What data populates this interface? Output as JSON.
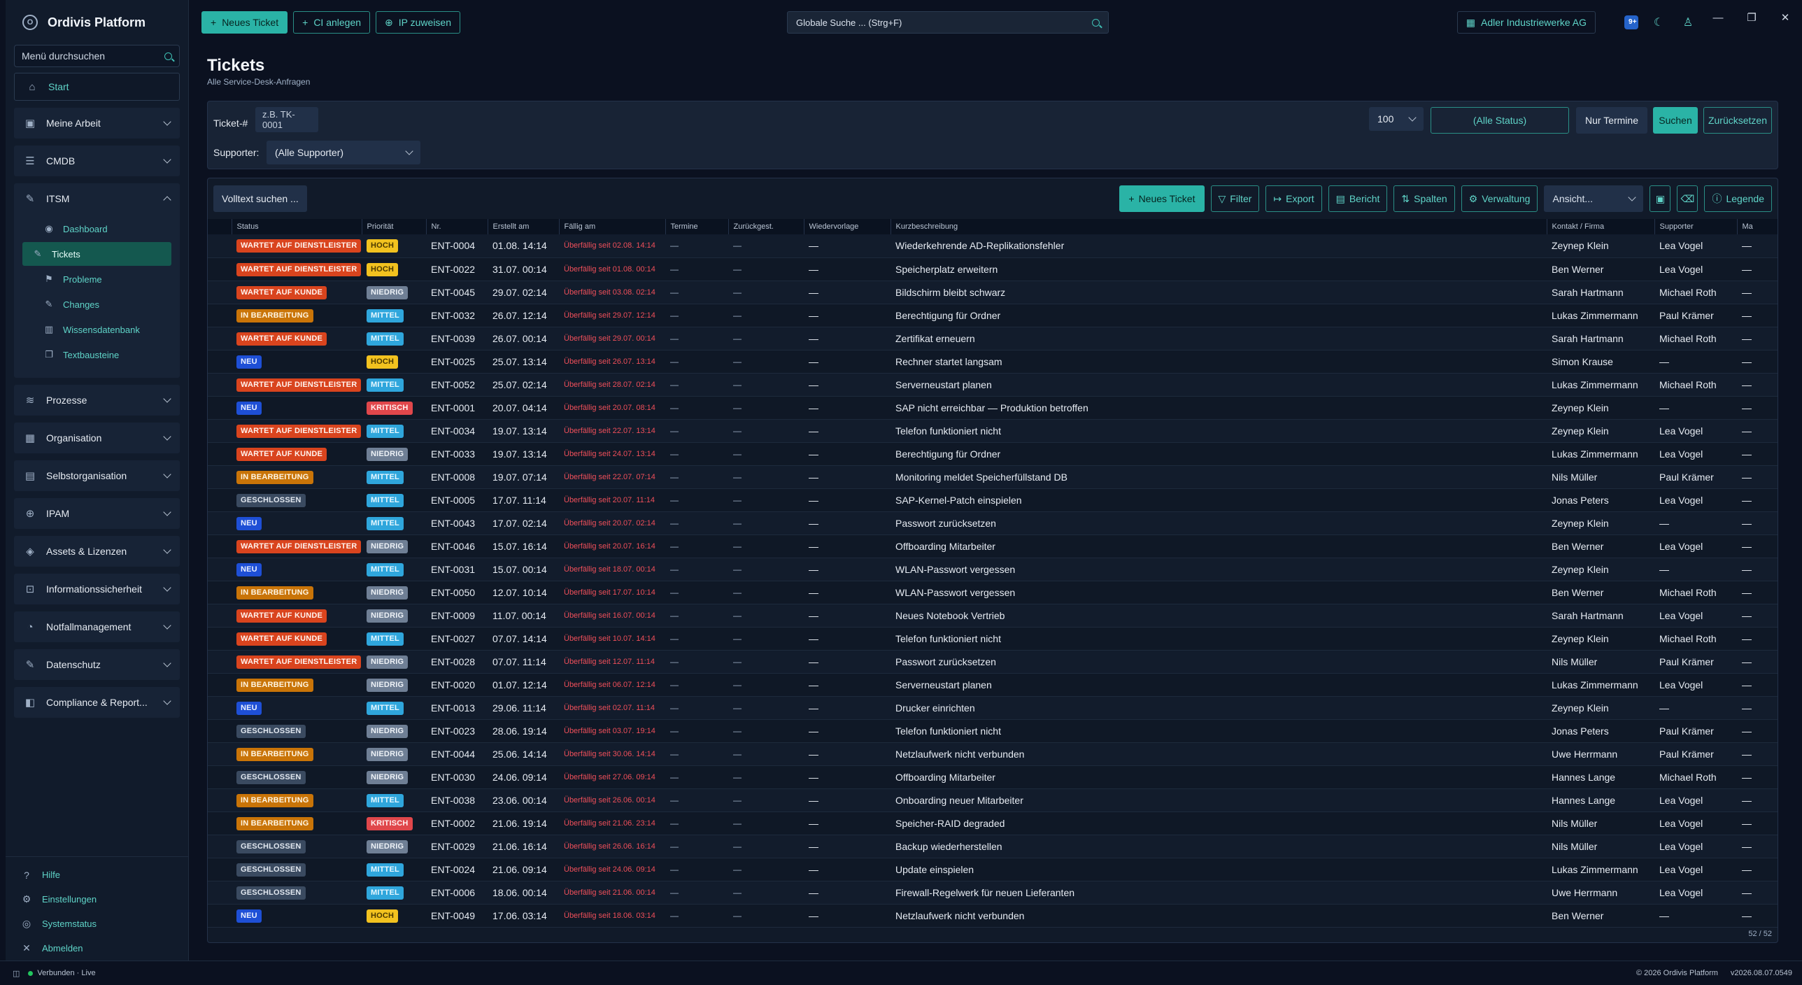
{
  "brand": {
    "name": "Ordivis Platform"
  },
  "sidebar": {
    "search_placeholder": "Menü durchsuchen",
    "start": "Start",
    "groups_top": [
      {
        "label": "Meine Arbeit",
        "icon": "briefcase-icon"
      },
      {
        "label": "CMDB",
        "icon": "database-icon"
      }
    ],
    "itsm": {
      "label": "ITSM",
      "items": [
        {
          "label": "Dashboard",
          "icon": "eye-icon"
        },
        {
          "label": "Tickets",
          "icon": "wrench-icon"
        },
        {
          "label": "Probleme",
          "icon": "flag-icon"
        },
        {
          "label": "Changes",
          "icon": "wrench-icon"
        },
        {
          "label": "Wissensdatenbank",
          "icon": "library-icon"
        },
        {
          "label": "Textbausteine",
          "icon": "copy-icon"
        }
      ]
    },
    "groups_bottom": [
      {
        "label": "Prozesse",
        "icon": "layers-icon"
      },
      {
        "label": "Organisation",
        "icon": "building-icon"
      },
      {
        "label": "Selbstorganisation",
        "icon": "clipboard-icon"
      },
      {
        "label": "IPAM",
        "icon": "network-icon"
      },
      {
        "label": "Assets & Lizenzen",
        "icon": "tag-icon"
      },
      {
        "label": "Informationssicherheit",
        "icon": "lock-icon"
      },
      {
        "label": "Notfallmanagement",
        "icon": "bell-icon"
      },
      {
        "label": "Datenschutz",
        "icon": "key-icon"
      },
      {
        "label": "Compliance & Report...",
        "icon": "report-icon"
      }
    ],
    "footer": [
      {
        "label": "Hilfe",
        "icon": "help-icon"
      },
      {
        "label": "Einstellungen",
        "icon": "gear-icon"
      },
      {
        "label": "Systemstatus",
        "icon": "status-icon"
      },
      {
        "label": "Abmelden",
        "icon": "close-icon"
      }
    ]
  },
  "topbar": {
    "new_ticket": "Neues Ticket",
    "ci_create": "CI anlegen",
    "ip_assign": "IP zuweisen",
    "global_search": "Globale Suche ... (Strg+F)",
    "company": "Adler Industriewerke AG",
    "notif_badge": "9+"
  },
  "page": {
    "title": "Tickets",
    "subtitle": "Alle Service-Desk-Anfragen"
  },
  "filters": {
    "ticket_label": "Ticket-#",
    "ticket_placeholder": "z.B. TK-0001",
    "supporter_label": "Supporter:",
    "supporter_value": "(Alle Supporter)",
    "limit_value": "100",
    "status_value": "(Alle Status)",
    "only_dates": "Nur Termine",
    "search": "Suchen",
    "reset": "Zurücksetzen"
  },
  "toolbar": {
    "fulltext": "Volltext suchen ...",
    "new_ticket": "Neues Ticket",
    "filter": "Filter",
    "export": "Export",
    "report": "Bericht",
    "columns": "Spalten",
    "admin": "Verwaltung",
    "view": "Ansicht...",
    "legend": "Legende"
  },
  "table": {
    "headers": [
      "Status",
      "Priorität",
      "Nr.",
      "Erstellt am",
      "Fällig am",
      "Termine",
      "Zurückgest.",
      "Wiedervorlage",
      "Kurzbeschreibung",
      "Kontakt / Firma",
      "Supporter",
      "Ma"
    ],
    "rows": [
      [
        "WARTET AUF DIENSTLEISTER",
        "HOCH",
        "ENT-0004",
        "01.08. 14:14",
        "Überfällig seit 02.08. 14:14",
        "—",
        "—",
        "Wiederkehrende AD-Replikationsfehler",
        "Zeynep Klein",
        "Lea Vogel",
        "—"
      ],
      [
        "WARTET AUF DIENSTLEISTER",
        "HOCH",
        "ENT-0022",
        "31.07. 00:14",
        "Überfällig seit 01.08. 00:14",
        "—",
        "—",
        "Speicherplatz erweitern",
        "Ben Werner",
        "Lea Vogel",
        "—"
      ],
      [
        "WARTET AUF KUNDE",
        "NIEDRIG",
        "ENT-0045",
        "29.07. 02:14",
        "Überfällig seit 03.08. 02:14",
        "—",
        "—",
        "Bildschirm bleibt schwarz",
        "Sarah Hartmann",
        "Michael Roth",
        "—"
      ],
      [
        "IN BEARBEITUNG",
        "MITTEL",
        "ENT-0032",
        "26.07. 12:14",
        "Überfällig seit 29.07. 12:14",
        "—",
        "—",
        "Berechtigung für Ordner",
        "Lukas Zimmermann",
        "Paul Krämer",
        "—"
      ],
      [
        "WARTET AUF KUNDE",
        "MITTEL",
        "ENT-0039",
        "26.07. 00:14",
        "Überfällig seit 29.07. 00:14",
        "—",
        "—",
        "Zertifikat erneuern",
        "Sarah Hartmann",
        "Michael Roth",
        "—"
      ],
      [
        "NEU",
        "HOCH",
        "ENT-0025",
        "25.07. 13:14",
        "Überfällig seit 26.07. 13:14",
        "—",
        "—",
        "Rechner startet langsam",
        "Simon Krause",
        "—",
        "—"
      ],
      [
        "WARTET AUF DIENSTLEISTER",
        "MITTEL",
        "ENT-0052",
        "25.07. 02:14",
        "Überfällig seit 28.07. 02:14",
        "—",
        "—",
        "Serverneustart planen",
        "Lukas Zimmermann",
        "Michael Roth",
        "—"
      ],
      [
        "NEU",
        "KRITISCH",
        "ENT-0001",
        "20.07. 04:14",
        "Überfällig seit 20.07. 08:14",
        "—",
        "—",
        "SAP nicht erreichbar — Produktion betroffen",
        "Zeynep Klein",
        "—",
        "—"
      ],
      [
        "WARTET AUF DIENSTLEISTER",
        "MITTEL",
        "ENT-0034",
        "19.07. 13:14",
        "Überfällig seit 22.07. 13:14",
        "—",
        "—",
        "Telefon funktioniert nicht",
        "Zeynep Klein",
        "Lea Vogel",
        "—"
      ],
      [
        "WARTET AUF KUNDE",
        "NIEDRIG",
        "ENT-0033",
        "19.07. 13:14",
        "Überfällig seit 24.07. 13:14",
        "—",
        "—",
        "Berechtigung für Ordner",
        "Lukas Zimmermann",
        "Lea Vogel",
        "—"
      ],
      [
        "IN BEARBEITUNG",
        "MITTEL",
        "ENT-0008",
        "19.07. 07:14",
        "Überfällig seit 22.07. 07:14",
        "—",
        "—",
        "Monitoring meldet Speicherfüllstand DB",
        "Nils Müller",
        "Paul Krämer",
        "—"
      ],
      [
        "GESCHLOSSEN",
        "MITTEL",
        "ENT-0005",
        "17.07. 11:14",
        "Überfällig seit 20.07. 11:14",
        "—",
        "—",
        "SAP-Kernel-Patch einspielen",
        "Jonas Peters",
        "Lea Vogel",
        "—"
      ],
      [
        "NEU",
        "MITTEL",
        "ENT-0043",
        "17.07. 02:14",
        "Überfällig seit 20.07. 02:14",
        "—",
        "—",
        "Passwort zurücksetzen",
        "Zeynep Klein",
        "—",
        "—"
      ],
      [
        "WARTET AUF DIENSTLEISTER",
        "NIEDRIG",
        "ENT-0046",
        "15.07. 16:14",
        "Überfällig seit 20.07. 16:14",
        "—",
        "—",
        "Offboarding Mitarbeiter",
        "Ben Werner",
        "Lea Vogel",
        "—"
      ],
      [
        "NEU",
        "MITTEL",
        "ENT-0031",
        "15.07. 00:14",
        "Überfällig seit 18.07. 00:14",
        "—",
        "—",
        "WLAN-Passwort vergessen",
        "Zeynep Klein",
        "—",
        "—"
      ],
      [
        "IN BEARBEITUNG",
        "NIEDRIG",
        "ENT-0050",
        "12.07. 10:14",
        "Überfällig seit 17.07. 10:14",
        "—",
        "—",
        "WLAN-Passwort vergessen",
        "Ben Werner",
        "Michael Roth",
        "—"
      ],
      [
        "WARTET AUF KUNDE",
        "NIEDRIG",
        "ENT-0009",
        "11.07. 00:14",
        "Überfällig seit 16.07. 00:14",
        "—",
        "—",
        "Neues Notebook Vertrieb",
        "Sarah Hartmann",
        "Lea Vogel",
        "—"
      ],
      [
        "WARTET AUF KUNDE",
        "MITTEL",
        "ENT-0027",
        "07.07. 14:14",
        "Überfällig seit 10.07. 14:14",
        "—",
        "—",
        "Telefon funktioniert nicht",
        "Zeynep Klein",
        "Michael Roth",
        "—"
      ],
      [
        "WARTET AUF DIENSTLEISTER",
        "NIEDRIG",
        "ENT-0028",
        "07.07. 11:14",
        "Überfällig seit 12.07. 11:14",
        "—",
        "—",
        "Passwort zurücksetzen",
        "Nils Müller",
        "Paul Krämer",
        "—"
      ],
      [
        "IN BEARBEITUNG",
        "NIEDRIG",
        "ENT-0020",
        "01.07. 12:14",
        "Überfällig seit 06.07. 12:14",
        "—",
        "—",
        "Serverneustart planen",
        "Lukas Zimmermann",
        "Lea Vogel",
        "—"
      ],
      [
        "NEU",
        "MITTEL",
        "ENT-0013",
        "29.06. 11:14",
        "Überfällig seit 02.07. 11:14",
        "—",
        "—",
        "Drucker einrichten",
        "Zeynep Klein",
        "—",
        "—"
      ],
      [
        "GESCHLOSSEN",
        "NIEDRIG",
        "ENT-0023",
        "28.06. 19:14",
        "Überfällig seit 03.07. 19:14",
        "—",
        "—",
        "Telefon funktioniert nicht",
        "Jonas Peters",
        "Paul Krämer",
        "—"
      ],
      [
        "IN BEARBEITUNG",
        "NIEDRIG",
        "ENT-0044",
        "25.06. 14:14",
        "Überfällig seit 30.06. 14:14",
        "—",
        "—",
        "Netzlaufwerk nicht verbunden",
        "Uwe Herrmann",
        "Paul Krämer",
        "—"
      ],
      [
        "GESCHLOSSEN",
        "NIEDRIG",
        "ENT-0030",
        "24.06. 09:14",
        "Überfällig seit 27.06. 09:14",
        "—",
        "—",
        "Offboarding Mitarbeiter",
        "Hannes Lange",
        "Michael Roth",
        "—"
      ],
      [
        "IN BEARBEITUNG",
        "MITTEL",
        "ENT-0038",
        "23.06. 00:14",
        "Überfällig seit 26.06. 00:14",
        "—",
        "—",
        "Onboarding neuer Mitarbeiter",
        "Hannes Lange",
        "Lea Vogel",
        "—"
      ],
      [
        "IN BEARBEITUNG",
        "KRITISCH",
        "ENT-0002",
        "21.06. 19:14",
        "Überfällig seit 21.06. 23:14",
        "—",
        "—",
        "Speicher-RAID degraded",
        "Nils Müller",
        "Lea Vogel",
        "—"
      ],
      [
        "GESCHLOSSEN",
        "NIEDRIG",
        "ENT-0029",
        "21.06. 16:14",
        "Überfällig seit 26.06. 16:14",
        "—",
        "—",
        "Backup wiederherstellen",
        "Nils Müller",
        "Lea Vogel",
        "—"
      ],
      [
        "GESCHLOSSEN",
        "MITTEL",
        "ENT-0024",
        "21.06. 09:14",
        "Überfällig seit 24.06. 09:14",
        "—",
        "—",
        "Update einspielen",
        "Lukas Zimmermann",
        "Lea Vogel",
        "—"
      ],
      [
        "GESCHLOSSEN",
        "MITTEL",
        "ENT-0006",
        "18.06. 00:14",
        "Überfällig seit 21.06. 00:14",
        "—",
        "—",
        "Firewall-Regelwerk für neuen Lieferanten",
        "Uwe Herrmann",
        "Lea Vogel",
        "—"
      ],
      [
        "NEU",
        "HOCH",
        "ENT-0049",
        "17.06. 03:14",
        "Überfällig seit 18.06. 03:14",
        "—",
        "—",
        "Netzlaufwerk nicht verbunden",
        "Ben Werner",
        "—",
        "—"
      ]
    ],
    "count": "52 / 52"
  },
  "statusbar": {
    "connection": "Verbunden · Live",
    "copyright": "© 2026 Ordivis Platform",
    "version": "v2026.08.07.0549"
  },
  "colors": {
    "accent": "#2ab3a6",
    "overdue": "#ef4f5a",
    "background": "#0b1120"
  }
}
